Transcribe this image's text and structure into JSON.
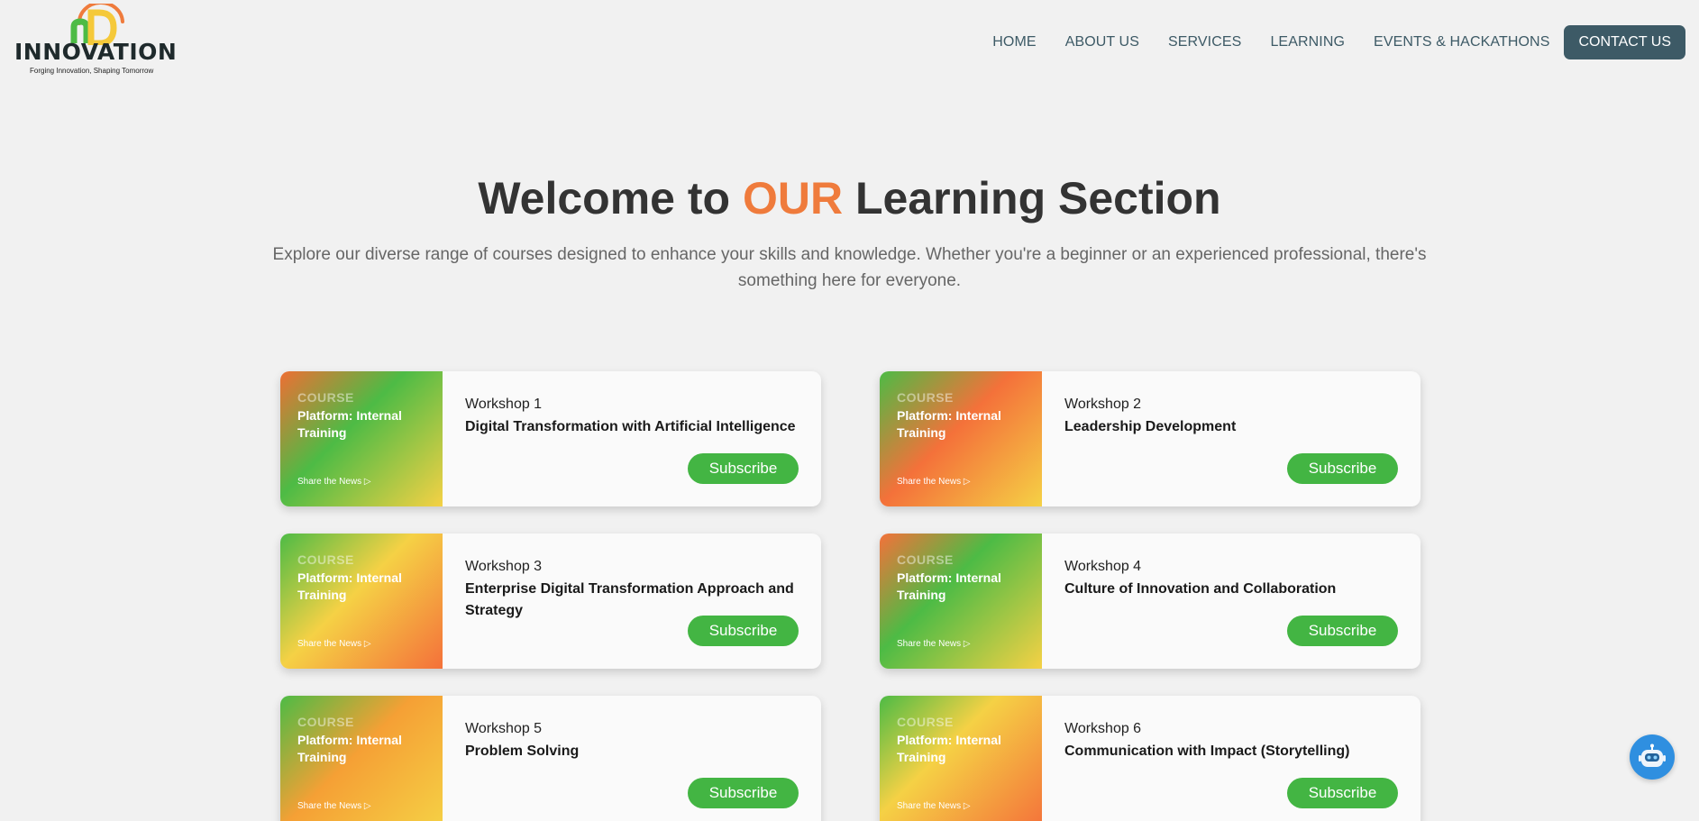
{
  "header": {
    "logo": {
      "wordmark": "INNOVATION",
      "tagline": "Forging Innovation, Shaping Tomorrow",
      "colors": {
        "green": "#4dbb45",
        "orange": "#ef7b3c",
        "yellow": "#f5c93a"
      }
    },
    "nav": [
      {
        "label": "HOME"
      },
      {
        "label": "ABOUT US"
      },
      {
        "label": "SERVICES"
      },
      {
        "label": "LEARNING"
      },
      {
        "label": "EVENTS & HACKATHONS"
      }
    ],
    "contact_label": "CONTACT US"
  },
  "hero": {
    "title_before": "Welcome to ",
    "title_accent": "OUR",
    "title_after": " Learning Section",
    "subtitle": "Explore our diverse range of courses designed to enhance your skills and knowledge. Whether you're a beginner or an experienced professional, there's something here for everyone."
  },
  "workshops": [
    {
      "tag": "COURSE",
      "platform": "Platform: Internal Training",
      "share": "Share the News ▷",
      "number": "Workshop 1",
      "title": "Digital Transformation with Artificial Intelligence",
      "button": "Subscribe"
    },
    {
      "tag": "COURSE",
      "platform": "Platform: Internal Training",
      "share": "Share the News ▷",
      "number": "Workshop 2",
      "title": "Leadership Development",
      "button": "Subscribe"
    },
    {
      "tag": "COURSE",
      "platform": "Platform: Internal Training",
      "share": "Share the News ▷",
      "number": "Workshop 3",
      "title": "Enterprise Digital Transformation Approach and Strategy",
      "button": "Subscribe"
    },
    {
      "tag": "COURSE",
      "platform": "Platform: Internal Training",
      "share": "Share the News ▷",
      "number": "Workshop 4",
      "title": "Culture of Innovation and Collaboration",
      "button": "Subscribe"
    },
    {
      "tag": "COURSE",
      "platform": "Platform: Internal Training",
      "share": "Share the News ▷",
      "number": "Workshop 5",
      "title": "Problem Solving",
      "button": "Subscribe"
    },
    {
      "tag": "COURSE",
      "platform": "Platform: Internal Training",
      "share": "Share the News ▷",
      "number": "Workshop 6",
      "title": "Communication with Impact (Storytelling)",
      "button": "Subscribe"
    }
  ],
  "chatbot": {
    "icon": "robot-icon",
    "color": "#2f8fe0"
  },
  "theme": {
    "accent": "#ef7b3c",
    "nav_color": "#3d5a66",
    "button_green": "#43b543",
    "background": "#f1f1f1"
  }
}
